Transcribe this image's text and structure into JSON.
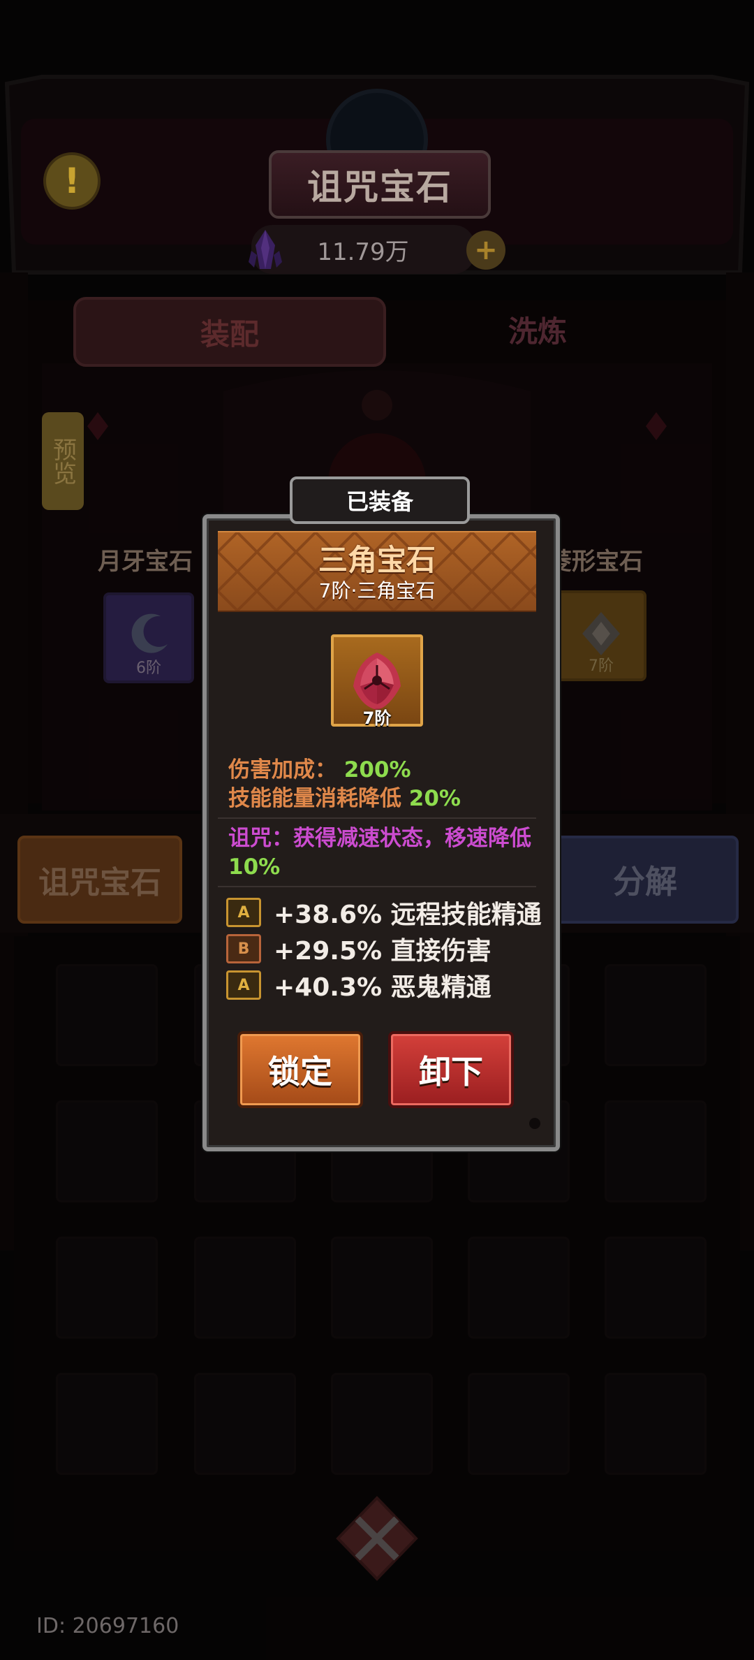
{
  "header": {
    "title": "诅咒宝石",
    "warning_icon": "!",
    "currency": {
      "amount": "11.79万",
      "icon": "purple-crystal-icon",
      "add_icon": "plus-icon"
    }
  },
  "tabs": [
    {
      "label": "装配"
    },
    {
      "label": "洗炼"
    }
  ],
  "preview_button": "预览",
  "slots": {
    "left": {
      "label": "月牙宝石",
      "tier": "6阶"
    },
    "right": {
      "label": "菱形宝石",
      "tier": "7阶"
    }
  },
  "category_button": "诅咒宝石",
  "disassemble_button": "分解",
  "footer": {
    "id_text": "ID: 20697160"
  },
  "popup": {
    "status_badge": "已装备",
    "item_name": "三角宝石",
    "item_subtitle": "7阶·三角宝石",
    "item_tier": "7阶",
    "stats": [
      {
        "label": "伤害加成：",
        "value": "200%"
      },
      {
        "label": "技能能量消耗降低",
        "value": "20%"
      }
    ],
    "curse": {
      "text": "诅咒：获得减速状态，移速降低",
      "value": "10%"
    },
    "affixes": [
      {
        "grade": "A",
        "text": "+38.6% 远程技能精通"
      },
      {
        "grade": "B",
        "text": "+29.5% 直接伤害"
      },
      {
        "grade": "A",
        "text": "+40.3% 恶鬼精通"
      }
    ],
    "lock_button": "锁定",
    "unequip_button": "卸下"
  },
  "colors": {
    "header_band": "#b06426",
    "stat_text": "#e0884a",
    "stat_value": "#8edc4e",
    "curse_text": "#cc4cd0",
    "lock_button": "#d06a28",
    "unequip_button": "#c0302c"
  }
}
